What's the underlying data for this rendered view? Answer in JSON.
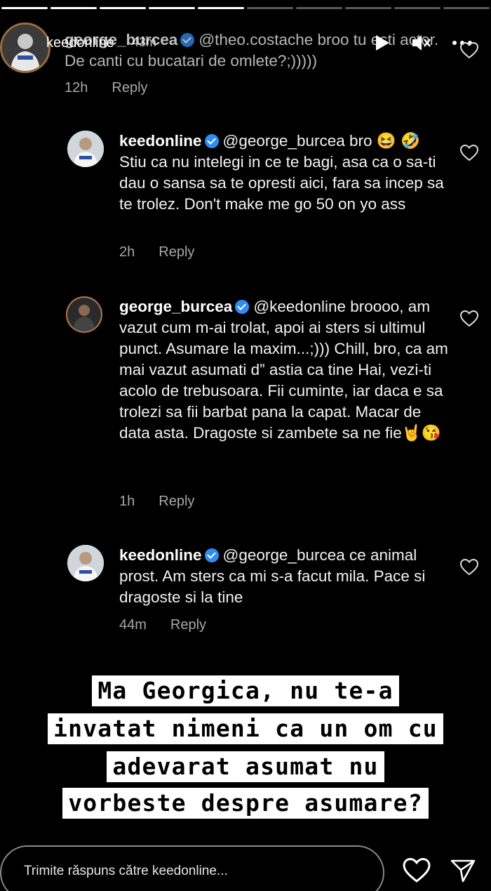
{
  "story": {
    "username": "keedonline",
    "time": "43m",
    "progress_done": 5,
    "progress_total": 10
  },
  "comments": [
    {
      "user": "george_burcea",
      "verified": true,
      "text": "@theo.costache broo tu esti actor. De canti cu bucatari de omlete?;)))))",
      "time": "12h",
      "reply": "Reply"
    },
    {
      "user": "keedonline",
      "verified": true,
      "text": "@george_burcea bro 😆 🤣 Stiu ca nu intelegi in ce te bagi, asa ca o sa-ti dau o sansa sa te opresti aici, fara sa incep sa te trolez. Don't make me go 50 on yo ass",
      "time": "2h",
      "reply": "Reply"
    },
    {
      "user": "george_burcea",
      "verified": true,
      "text": "@keedonline broooo, am vazut cum m-ai trolat, apoi ai sters si ultimul punct. Asumare la maxim...;))) Chill, bro, ca am mai vazut asumati d” astia ca tine Hai, vezi-ti acolo de trebusoara. Fii cuminte, iar daca e sa trolezi sa fii barbat pana la capat. Macar de data asta. Dragoste si zambete sa ne fie🤘😘",
      "time": "1h",
      "reply": "Reply"
    },
    {
      "user": "keedonline",
      "verified": true,
      "text": "@george_burcea ce animal prost. Am sters ca mi s-a facut mila. Pace si dragoste si la tine",
      "time": "44m",
      "reply": "Reply"
    }
  ],
  "overlay_lines": [
    "Ma Georgica, nu te-a",
    "invatat nimeni ca un om cu",
    "adevarat asumat nu",
    "vorbeste despre asumare?"
  ],
  "reply_bar": {
    "placeholder": "Trimite răspuns către keedonline..."
  },
  "icons": {
    "play": "play-icon",
    "mute": "speaker-muted-icon",
    "more": "more-dots-icon",
    "like": "heart-icon",
    "send": "send-icon"
  },
  "colors": {
    "background": "#000000",
    "verified": "#2f8cf5",
    "meta_text": "#a8a8a8",
    "overlay_bg": "#ffffff"
  }
}
